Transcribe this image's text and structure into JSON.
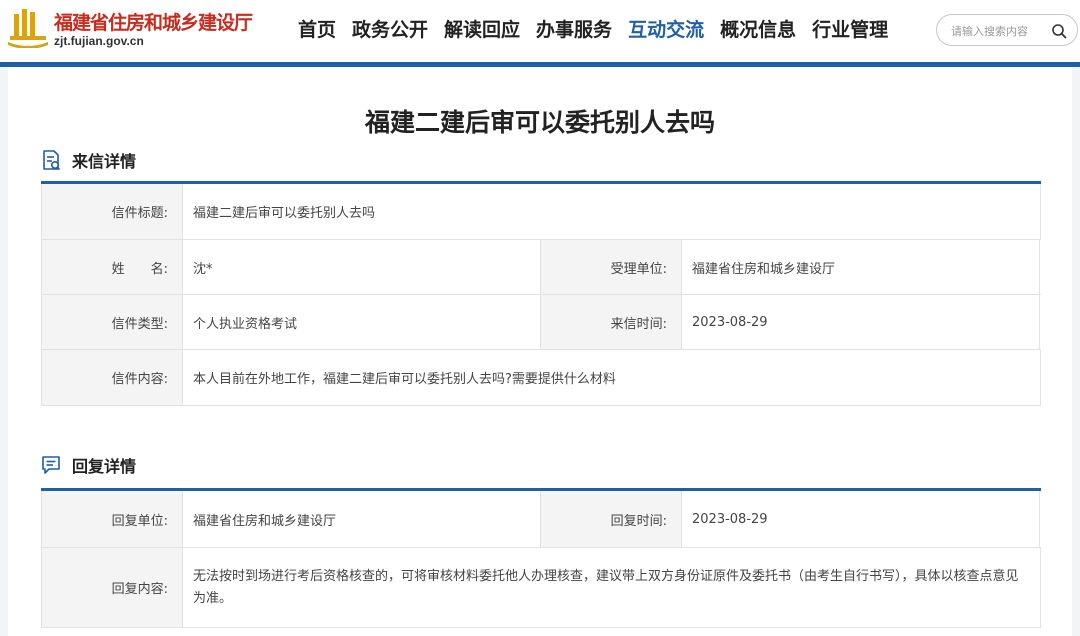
{
  "site": {
    "name": "福建省住房和城乡建设厅",
    "domain": "zjt.fujian.gov.cn"
  },
  "nav": {
    "items": [
      {
        "label": "首页"
      },
      {
        "label": "政务公开"
      },
      {
        "label": "解读回应"
      },
      {
        "label": "办事服务"
      },
      {
        "label": "互动交流",
        "active": true
      },
      {
        "label": "概况信息"
      },
      {
        "label": "行业管理"
      }
    ],
    "search_placeholder": "请输入搜索内容"
  },
  "page": {
    "title": "福建二建后审可以委托别人去吗"
  },
  "letter": {
    "section_title": "来信详情",
    "subject_label": "信件标题:",
    "subject": "福建二建后审可以委托别人去吗",
    "name_label": "姓　　名:",
    "name": "沈*",
    "unit_label": "受理单位:",
    "unit": "福建省住房和城乡建设厅",
    "type_label": "信件类型:",
    "type": "个人执业资格考试",
    "date_label": "来信时间:",
    "date": "2023-08-29",
    "content_label": "信件内容:",
    "content": "本人目前在外地工作，福建二建后审可以委托别人去吗?需要提供什么材料"
  },
  "reply": {
    "section_title": "回复详情",
    "unit_label": "回复单位:",
    "unit": "福建省住房和城乡建设厅",
    "date_label": "回复时间:",
    "date": "2023-08-29",
    "content_label": "回复内容:",
    "content": "无法按时到场进行考后资格核查的，可将审核材料委托他人办理核查，建议带上双方身份证原件及委托书（由考生自行书写），具体以核查点意见为准。"
  },
  "colors": {
    "brand_blue": "#1f5fa8",
    "logo_red": "#c62d1f"
  }
}
